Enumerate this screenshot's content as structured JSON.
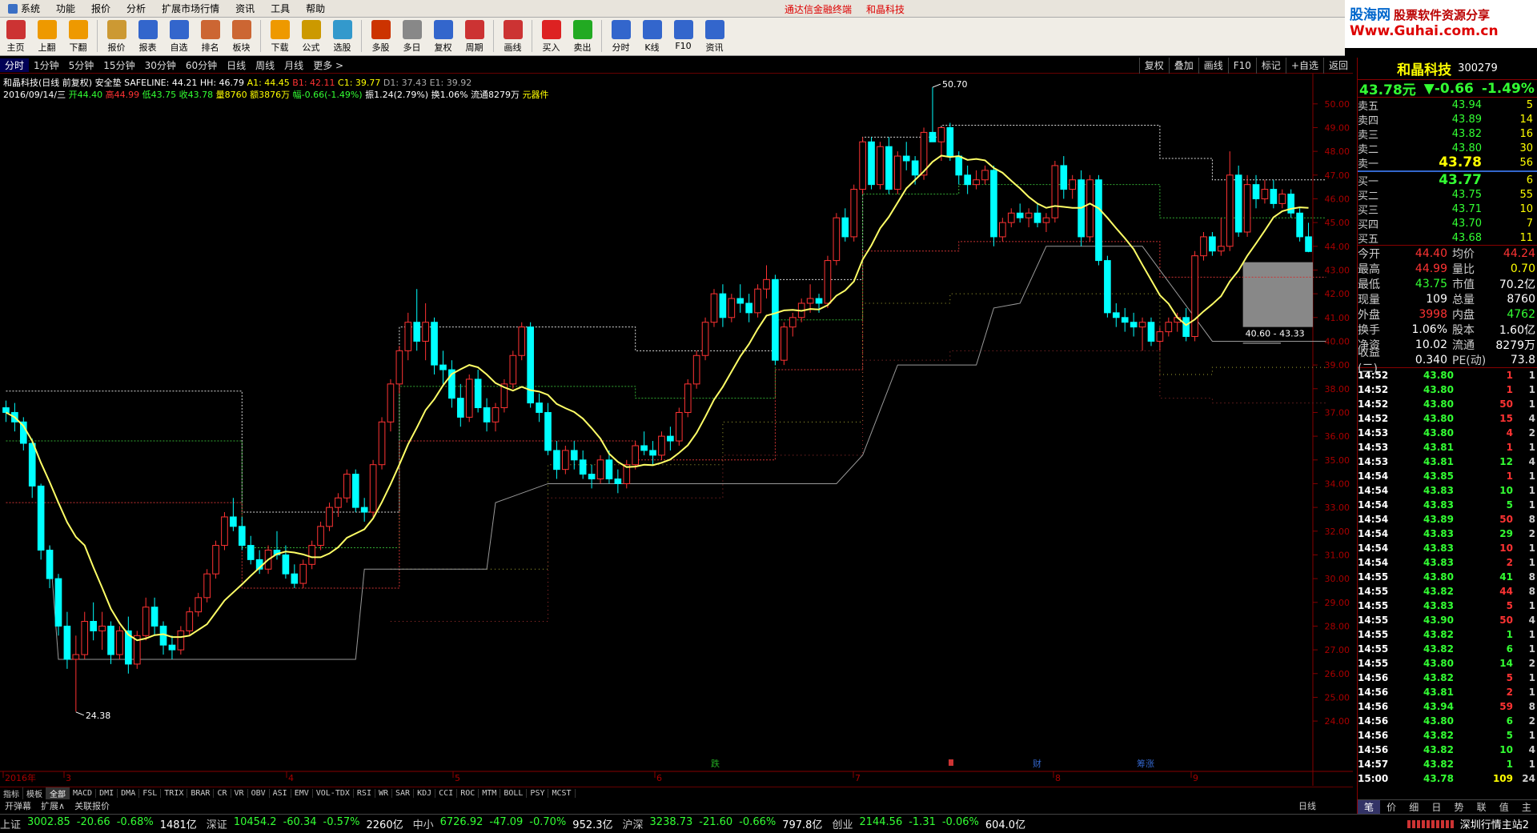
{
  "menubar": {
    "items": [
      "系统",
      "功能",
      "报价",
      "分析",
      "扩展市场行情",
      "资讯",
      "工具",
      "帮助"
    ],
    "center": [
      "通达信金融终端",
      "和晶科技"
    ]
  },
  "brand": {
    "site": "股海网",
    "slogan": "股票软件资源分享",
    "url": "Www.Guhai.com.cn"
  },
  "toolbar": {
    "items": [
      "主页",
      "上翻",
      "下翻",
      "报价",
      "报表",
      "自选",
      "排名",
      "板块",
      "下载",
      "公式",
      "选股",
      "多股",
      "多日",
      "复权",
      "周期",
      "画线",
      "买入",
      "卖出",
      "分时",
      "K线",
      "F10",
      "资讯"
    ],
    "icon_labels": [
      "F6",
      "F8",
      "F10"
    ]
  },
  "periodbar": {
    "items": [
      "分时",
      "1分钟",
      "5分钟",
      "15分钟",
      "30分钟",
      "60分钟",
      "日线",
      "周线",
      "月线",
      "更多 >"
    ],
    "active": 0,
    "right_buttons": [
      "复权",
      "叠加",
      "画线",
      "F10",
      "标记",
      "+自选",
      "返回"
    ]
  },
  "info": {
    "line1": {
      "prefix": "和晶科技(日线 前复权) 安全垫",
      "safeline": "SAFELINE: 44.21",
      "hh": "HH: 46.79",
      "a1": "A1: 44.45",
      "b1": "B1: 42.11",
      "c1": "C1: 39.77",
      "d1": "D1: 37.43",
      "e1": "E1: 39.92"
    },
    "line2": {
      "date": "2016/09/14/三",
      "open": "开44.40",
      "high": "高44.99",
      "low": "低43.75",
      "close": "收43.78",
      "vol": "量8760",
      "amount": "额3876万",
      "change": "幅-0.66(-1.49%)",
      "amp": "振1.24(2.79%)",
      "turnover": "换1.06%",
      "float": "流通8279万",
      "sector": "元器件"
    }
  },
  "chart_data": {
    "type": "candlestick",
    "yaxis": [
      "50.00",
      "49.00",
      "48.00",
      "47.00",
      "46.00",
      "45.00",
      "44.00",
      "43.00",
      "42.00",
      "41.00",
      "40.00",
      "39.00",
      "38.00",
      "37.00",
      "36.00",
      "35.00",
      "34.00",
      "33.00",
      "32.00",
      "31.00",
      "30.00",
      "29.00",
      "28.00",
      "27.00",
      "26.00",
      "25.00",
      "24.00"
    ],
    "ylim": [
      23.7,
      50.6
    ],
    "annotations": [
      "50.70",
      "24.38",
      "40.60 - 43.33"
    ],
    "xaxis": [
      "2016年",
      "3",
      "4",
      "5",
      "6",
      "7",
      "8",
      "9"
    ],
    "event_labels": [
      "跌",
      "",
      "财",
      "筹涨"
    ],
    "candles": [
      [
        37.2,
        37.5,
        36.6,
        37.0
      ],
      [
        37.0,
        37.4,
        36.2,
        36.6
      ],
      [
        36.6,
        36.8,
        35.4,
        35.7
      ],
      [
        35.7,
        35.9,
        33.4,
        33.9
      ],
      [
        33.9,
        34.0,
        30.8,
        31.2
      ],
      [
        31.2,
        31.4,
        29.6,
        30.0
      ],
      [
        30.0,
        30.2,
        27.6,
        28.0
      ],
      [
        28.0,
        28.6,
        26.2,
        26.6
      ],
      [
        26.6,
        27.6,
        24.4,
        26.8
      ],
      [
        26.8,
        28.6,
        26.6,
        28.2
      ],
      [
        28.2,
        29.0,
        27.4,
        27.8
      ],
      [
        27.8,
        28.6,
        27.0,
        28.0
      ],
      [
        28.0,
        28.2,
        26.4,
        26.8
      ],
      [
        26.8,
        28.0,
        26.6,
        27.8
      ],
      [
        27.8,
        28.4,
        26.0,
        26.4
      ],
      [
        26.4,
        27.8,
        26.2,
        27.6
      ],
      [
        27.6,
        29.2,
        27.4,
        28.8
      ],
      [
        28.8,
        29.2,
        27.6,
        28.0
      ],
      [
        28.0,
        28.2,
        26.8,
        27.2
      ],
      [
        27.2,
        27.6,
        26.6,
        27.0
      ],
      [
        27.0,
        28.0,
        26.8,
        27.8
      ],
      [
        27.8,
        28.8,
        27.6,
        28.6
      ],
      [
        28.6,
        29.4,
        28.4,
        29.2
      ],
      [
        29.2,
        30.4,
        29.0,
        30.2
      ],
      [
        30.2,
        31.6,
        30.0,
        31.4
      ],
      [
        31.4,
        32.8,
        31.2,
        32.6
      ],
      [
        32.6,
        33.4,
        32.0,
        32.2
      ],
      [
        32.2,
        32.6,
        31.2,
        31.4
      ],
      [
        31.4,
        31.8,
        30.6,
        30.8
      ],
      [
        30.8,
        31.2,
        30.2,
        30.4
      ],
      [
        30.4,
        31.4,
        30.2,
        31.2
      ],
      [
        31.2,
        32.0,
        30.8,
        31.0
      ],
      [
        31.0,
        31.4,
        30.0,
        30.2
      ],
      [
        30.2,
        30.6,
        29.6,
        29.8
      ],
      [
        29.8,
        30.8,
        29.6,
        30.6
      ],
      [
        30.6,
        31.6,
        30.4,
        31.4
      ],
      [
        31.4,
        32.4,
        31.2,
        32.2
      ],
      [
        32.2,
        33.2,
        32.0,
        33.0
      ],
      [
        33.0,
        33.6,
        32.6,
        33.4
      ],
      [
        33.4,
        34.6,
        33.2,
        34.4
      ],
      [
        34.4,
        34.6,
        32.8,
        33.0
      ],
      [
        33.0,
        33.4,
        32.4,
        32.8
      ],
      [
        32.8,
        35.0,
        32.6,
        34.8
      ],
      [
        34.8,
        36.8,
        34.6,
        36.6
      ],
      [
        36.6,
        38.4,
        36.2,
        38.2
      ],
      [
        38.2,
        39.8,
        37.8,
        39.6
      ],
      [
        39.6,
        41.2,
        39.2,
        40.8
      ],
      [
        40.8,
        42.2,
        39.6,
        40.0
      ],
      [
        40.0,
        41.6,
        39.2,
        40.8
      ],
      [
        40.8,
        41.0,
        38.6,
        39.0
      ],
      [
        39.0,
        39.6,
        38.2,
        38.8
      ],
      [
        38.8,
        39.2,
        37.2,
        37.6
      ],
      [
        37.6,
        38.2,
        36.4,
        36.8
      ],
      [
        36.8,
        38.6,
        36.6,
        38.4
      ],
      [
        38.4,
        38.8,
        37.0,
        37.2
      ],
      [
        37.2,
        37.6,
        36.2,
        36.6
      ],
      [
        36.6,
        37.4,
        36.2,
        37.2
      ],
      [
        37.2,
        38.4,
        37.0,
        38.2
      ],
      [
        38.2,
        39.6,
        38.0,
        39.4
      ],
      [
        39.4,
        40.8,
        39.2,
        40.6
      ],
      [
        40.6,
        40.8,
        37.2,
        37.4
      ],
      [
        37.4,
        37.8,
        36.6,
        37.0
      ],
      [
        37.0,
        37.4,
        35.2,
        35.4
      ],
      [
        35.4,
        35.8,
        34.2,
        34.6
      ],
      [
        34.6,
        35.6,
        34.4,
        35.4
      ],
      [
        35.4,
        35.8,
        34.6,
        35.0
      ],
      [
        35.0,
        35.4,
        34.2,
        34.4
      ],
      [
        34.4,
        34.8,
        33.8,
        34.2
      ],
      [
        34.2,
        35.2,
        34.0,
        35.0
      ],
      [
        35.0,
        35.4,
        34.0,
        34.2
      ],
      [
        34.2,
        34.6,
        33.6,
        34.0
      ],
      [
        34.0,
        35.0,
        33.8,
        34.8
      ],
      [
        34.8,
        35.8,
        34.6,
        35.6
      ],
      [
        35.6,
        36.2,
        35.2,
        35.4
      ],
      [
        35.4,
        35.8,
        34.8,
        35.2
      ],
      [
        35.2,
        36.2,
        35.0,
        36.0
      ],
      [
        36.0,
        36.4,
        35.4,
        35.8
      ],
      [
        35.8,
        37.2,
        35.6,
        37.0
      ],
      [
        37.0,
        38.4,
        36.8,
        38.2
      ],
      [
        38.2,
        39.6,
        38.0,
        39.4
      ],
      [
        39.4,
        41.0,
        39.2,
        40.8
      ],
      [
        40.8,
        42.2,
        40.6,
        42.0
      ],
      [
        42.0,
        42.4,
        40.6,
        41.0
      ],
      [
        41.0,
        42.0,
        40.8,
        41.8
      ],
      [
        41.8,
        42.4,
        41.2,
        41.6
      ],
      [
        41.6,
        42.0,
        40.8,
        41.2
      ],
      [
        41.2,
        42.4,
        41.0,
        42.2
      ],
      [
        42.2,
        43.2,
        41.8,
        42.6
      ],
      [
        42.6,
        42.8,
        39.0,
        39.2
      ],
      [
        39.2,
        40.8,
        39.0,
        40.6
      ],
      [
        40.6,
        41.2,
        40.2,
        41.0
      ],
      [
        41.0,
        41.8,
        40.8,
        41.6
      ],
      [
        41.6,
        42.4,
        41.2,
        41.8
      ],
      [
        41.8,
        42.0,
        41.2,
        41.6
      ],
      [
        41.6,
        43.6,
        41.4,
        43.4
      ],
      [
        43.4,
        45.4,
        43.2,
        45.2
      ],
      [
        45.2,
        45.6,
        44.2,
        44.4
      ],
      [
        44.4,
        46.6,
        44.2,
        46.4
      ],
      [
        46.4,
        48.6,
        46.2,
        48.4
      ],
      [
        48.4,
        48.6,
        46.4,
        46.6
      ],
      [
        46.6,
        48.4,
        46.4,
        48.2
      ],
      [
        48.2,
        48.6,
        46.2,
        46.4
      ],
      [
        46.4,
        48.0,
        46.2,
        47.8
      ],
      [
        47.8,
        48.4,
        47.2,
        47.6
      ],
      [
        47.6,
        47.8,
        46.6,
        47.0
      ],
      [
        47.0,
        49.0,
        46.8,
        48.8
      ],
      [
        48.8,
        50.7,
        48.6,
        48.4
      ],
      [
        48.4,
        49.0,
        47.6,
        49.0
      ],
      [
        49.0,
        49.2,
        47.6,
        47.8
      ],
      [
        47.8,
        48.0,
        46.6,
        47.0
      ],
      [
        47.0,
        47.4,
        46.2,
        46.6
      ],
      [
        46.6,
        47.2,
        46.4,
        46.8
      ],
      [
        46.8,
        47.4,
        46.6,
        47.2
      ],
      [
        47.2,
        47.4,
        44.0,
        44.4
      ],
      [
        44.4,
        45.2,
        44.2,
        45.0
      ],
      [
        45.0,
        45.6,
        44.8,
        45.4
      ],
      [
        45.4,
        45.8,
        45.0,
        45.2
      ],
      [
        45.2,
        45.6,
        44.8,
        45.4
      ],
      [
        45.4,
        45.8,
        44.8,
        45.0
      ],
      [
        45.0,
        45.4,
        44.6,
        45.2
      ],
      [
        45.2,
        47.6,
        45.0,
        47.4
      ],
      [
        47.4,
        47.8,
        46.0,
        46.4
      ],
      [
        46.4,
        47.0,
        46.0,
        46.8
      ],
      [
        46.8,
        47.2,
        44.0,
        44.4
      ],
      [
        44.4,
        47.0,
        44.2,
        46.8
      ],
      [
        46.8,
        47.0,
        43.2,
        43.4
      ],
      [
        43.4,
        43.6,
        41.0,
        41.2
      ],
      [
        41.2,
        41.6,
        40.6,
        41.0
      ],
      [
        41.0,
        41.4,
        40.4,
        40.8
      ],
      [
        40.8,
        41.2,
        40.2,
        40.6
      ],
      [
        40.6,
        41.0,
        39.6,
        40.8
      ],
      [
        40.8,
        41.0,
        39.8,
        40.0
      ],
      [
        40.0,
        40.6,
        39.6,
        40.4
      ],
      [
        40.4,
        41.0,
        40.2,
        40.8
      ],
      [
        40.8,
        41.2,
        40.4,
        41.0
      ],
      [
        41.0,
        41.4,
        40.0,
        40.2
      ],
      [
        40.2,
        43.8,
        40.0,
        43.6
      ],
      [
        43.6,
        44.6,
        43.4,
        44.4
      ],
      [
        44.4,
        44.6,
        43.6,
        43.8
      ],
      [
        43.8,
        45.2,
        43.6,
        44.0
      ],
      [
        44.0,
        48.0,
        43.8,
        47.0
      ],
      [
        47.0,
        47.4,
        44.4,
        44.6
      ],
      [
        44.6,
        47.0,
        44.4,
        46.6
      ],
      [
        46.6,
        47.0,
        45.6,
        46.0
      ],
      [
        46.0,
        46.8,
        45.8,
        46.4
      ],
      [
        46.4,
        46.8,
        45.6,
        45.8
      ],
      [
        45.8,
        46.4,
        45.6,
        46.2
      ],
      [
        46.2,
        46.4,
        45.2,
        45.4
      ],
      [
        45.4,
        45.6,
        44.2,
        44.4
      ],
      [
        44.4,
        44.99,
        43.75,
        43.78
      ]
    ]
  },
  "tabbar": {
    "items": [
      "指标",
      "模板",
      "全部",
      "MACD",
      "DMI",
      "DMA",
      "FSL",
      "TRIX",
      "BRAR",
      "CR",
      "VR",
      "OBV",
      "ASI",
      "EMV",
      "VOL-TDX",
      "RSI",
      "WR",
      "SAR",
      "KDJ",
      "CCI",
      "ROC",
      "MTM",
      "BOLL",
      "PSY",
      "MCST"
    ],
    "active": 2,
    "row2": [
      "开弹幕",
      "扩展∧",
      "关联报价"
    ],
    "right": "日线"
  },
  "statusbar": [
    {
      "name": "上证",
      "price": "3002.85",
      "chg": "-20.66",
      "pct": "-0.68%",
      "amt": "1481亿"
    },
    {
      "name": "深证",
      "price": "10454.2",
      "chg": "-60.34",
      "pct": "-0.57%",
      "amt": "2260亿"
    },
    {
      "name": "中小",
      "price": "6726.92",
      "chg": "-47.09",
      "pct": "-0.70%",
      "amt": "952.3亿"
    },
    {
      "name": "沪深",
      "price": "3238.73",
      "chg": "-21.60",
      "pct": "-0.66%",
      "amt": "797.8亿"
    },
    {
      "name": "创业",
      "price": "2144.56",
      "chg": "-1.31",
      "pct": "-0.06%",
      "amt": "604.0亿"
    }
  ],
  "status_right": "深圳行情主站2",
  "quote": {
    "name": "和晶科技",
    "code": "300279",
    "price": "43.78元",
    "chg": "▼-0.66",
    "pct": "-1.49%",
    "sell": [
      {
        "label": "卖五",
        "price": "43.94",
        "vol": "5"
      },
      {
        "label": "卖四",
        "price": "43.89",
        "vol": "14"
      },
      {
        "label": "卖三",
        "price": "43.82",
        "vol": "16"
      },
      {
        "label": "卖二",
        "price": "43.80",
        "vol": "30"
      },
      {
        "label": "卖一",
        "price": "43.78",
        "vol": "56"
      }
    ],
    "buy": [
      {
        "label": "买一",
        "price": "43.77",
        "vol": "6"
      },
      {
        "label": "买二",
        "price": "43.75",
        "vol": "55"
      },
      {
        "label": "买三",
        "price": "43.71",
        "vol": "10"
      },
      {
        "label": "买四",
        "price": "43.70",
        "vol": "7"
      },
      {
        "label": "买五",
        "price": "43.68",
        "vol": "11"
      }
    ],
    "stats": [
      {
        "l": "今开",
        "v": "44.40",
        "vc": "r",
        "l2": "均价",
        "v2": "44.24",
        "v2c": "r"
      },
      {
        "l": "最高",
        "v": "44.99",
        "vc": "r",
        "l2": "量比",
        "v2": "0.70",
        "v2c": "y"
      },
      {
        "l": "最低",
        "v": "43.75",
        "vc": "gr",
        "l2": "市值",
        "v2": "70.2亿",
        "v2c": "w"
      },
      {
        "l": "现量",
        "v": "109",
        "vc": "w",
        "l2": "总量",
        "v2": "8760",
        "v2c": "w"
      },
      {
        "l": "外盘",
        "v": "3998",
        "vc": "r",
        "l2": "内盘",
        "v2": "4762",
        "v2c": "gr"
      },
      {
        "l": "换手",
        "v": "1.06%",
        "vc": "w",
        "l2": "股本",
        "v2": "1.60亿",
        "v2c": "w"
      },
      {
        "l": "净资",
        "v": "10.02",
        "vc": "w",
        "l2": "流通",
        "v2": "8279万",
        "v2c": "w"
      },
      {
        "l": "收益(二)",
        "v": "0.340",
        "vc": "w",
        "l2": "PE(动)",
        "v2": "73.8",
        "v2c": "w"
      }
    ],
    "ticks": [
      [
        "14:52",
        "43.80",
        "1",
        "1",
        "r"
      ],
      [
        "14:52",
        "43.80",
        "1",
        "1",
        "r"
      ],
      [
        "14:52",
        "43.80",
        "50",
        "1",
        "r"
      ],
      [
        "14:52",
        "43.80",
        "15",
        "4",
        "r"
      ],
      [
        "14:53",
        "43.80",
        "4",
        "2",
        "r"
      ],
      [
        "14:53",
        "43.81",
        "1",
        "1",
        "r"
      ],
      [
        "14:53",
        "43.81",
        "12",
        "4",
        "gr"
      ],
      [
        "14:54",
        "43.85",
        "1",
        "1",
        "r"
      ],
      [
        "14:54",
        "43.83",
        "10",
        "1",
        "gr"
      ],
      [
        "14:54",
        "43.83",
        "5",
        "1",
        "gr"
      ],
      [
        "14:54",
        "43.89",
        "50",
        "8",
        "r"
      ],
      [
        "14:54",
        "43.83",
        "29",
        "2",
        "gr"
      ],
      [
        "14:54",
        "43.83",
        "10",
        "1",
        "r"
      ],
      [
        "14:54",
        "43.83",
        "2",
        "1",
        "r"
      ],
      [
        "14:55",
        "43.80",
        "41",
        "8",
        "gr"
      ],
      [
        "14:55",
        "43.82",
        "44",
        "8",
        "r"
      ],
      [
        "14:55",
        "43.83",
        "5",
        "1",
        "r"
      ],
      [
        "14:55",
        "43.90",
        "50",
        "4",
        "r"
      ],
      [
        "14:55",
        "43.82",
        "1",
        "1",
        "gr"
      ],
      [
        "14:55",
        "43.82",
        "6",
        "1",
        "gr"
      ],
      [
        "14:55",
        "43.80",
        "14",
        "2",
        "gr"
      ],
      [
        "14:56",
        "43.82",
        "5",
        "1",
        "r"
      ],
      [
        "14:56",
        "43.81",
        "2",
        "1",
        "r"
      ],
      [
        "14:56",
        "43.94",
        "59",
        "8",
        "r"
      ],
      [
        "14:56",
        "43.80",
        "6",
        "2",
        "gr"
      ],
      [
        "14:56",
        "43.82",
        "5",
        "1",
        "gr"
      ],
      [
        "14:56",
        "43.82",
        "10",
        "4",
        "gr"
      ],
      [
        "14:57",
        "43.82",
        "1",
        "1",
        "gr"
      ],
      [
        "15:00",
        "43.78",
        "109",
        "24",
        "y"
      ]
    ],
    "bottom_tabs": [
      "笔",
      "价",
      "细",
      "日",
      "势",
      "联",
      "值",
      "主"
    ]
  }
}
